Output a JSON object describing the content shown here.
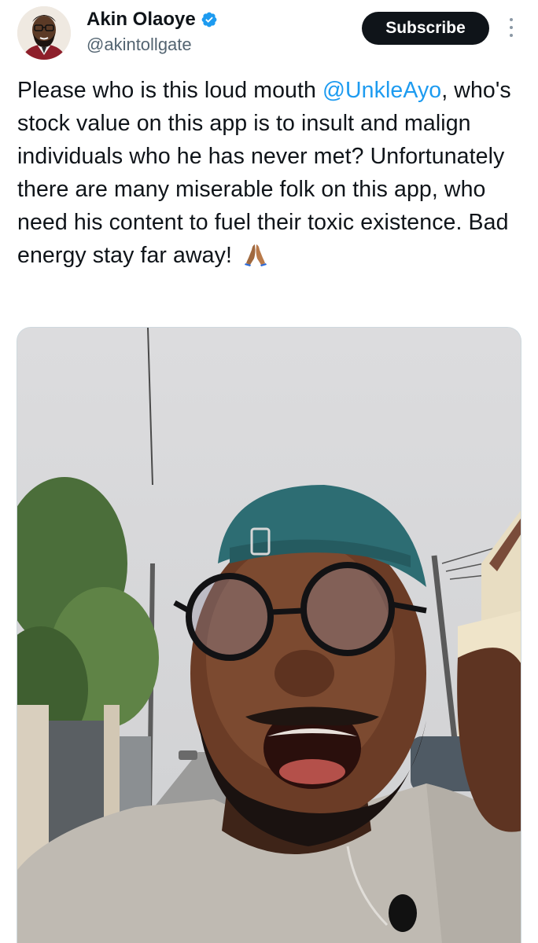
{
  "author": {
    "display_name": "Akin Olaoye",
    "handle": "@akintollgate",
    "verified_icon": "verified-badge-icon",
    "verified_color": "#1d9bf0"
  },
  "actions": {
    "subscribe_label": "Subscribe",
    "more_icon": "more-vertical-icon"
  },
  "tweet": {
    "text_before": "Please who is this loud mouth ",
    "mention": "@UnkleAyo",
    "text_after": ", who's stock value on this app is to insult and malign individuals who he has never met?  Unfortunately there are many miserable folk on this app, who need his content to fuel their toxic existence. Bad energy stay far away! ",
    "emoji_icon": "folded-hands-icon",
    "mention_color": "#1d9bf0"
  },
  "media": {
    "type": "video-still",
    "subject": "selfie-of-shouting-man-in-teal-cap-and-glasses"
  }
}
